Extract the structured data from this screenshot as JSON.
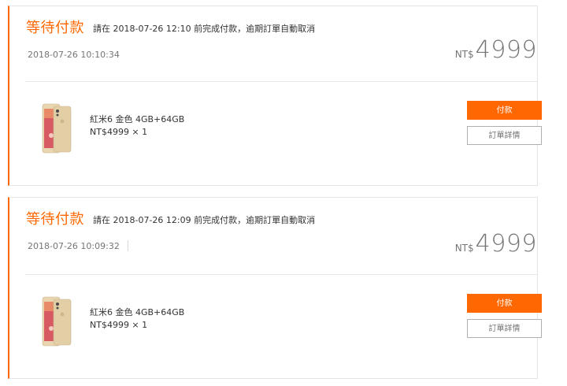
{
  "orders": [
    {
      "status": "等待付款",
      "deadline": "請在 2018-07-26 12:10 前完成付款，逾期訂單自動取消",
      "order_time": "2018-07-26 10:10:34",
      "currency": "NT$",
      "total": "4999",
      "product_name": "紅米6 金色 4GB+64GB",
      "product_price": "NT$4999 × 1",
      "pay_label": "付款",
      "detail_label": "訂單詳情"
    },
    {
      "status": "等待付款",
      "deadline": "請在 2018-07-26 12:09 前完成付款，逾期訂單自動取消",
      "order_time": "2018-07-26 10:09:32",
      "currency": "NT$",
      "total": "4999",
      "product_name": "紅米6 金色 4GB+64GB",
      "product_price": "NT$4999 × 1",
      "pay_label": "付款",
      "detail_label": "訂單詳情"
    }
  ],
  "colors": {
    "accent": "#ff6700",
    "border": "#e4e4e4",
    "muted_text": "#757575"
  },
  "icons": {
    "product_thumbnail": "phone-gold-image"
  }
}
